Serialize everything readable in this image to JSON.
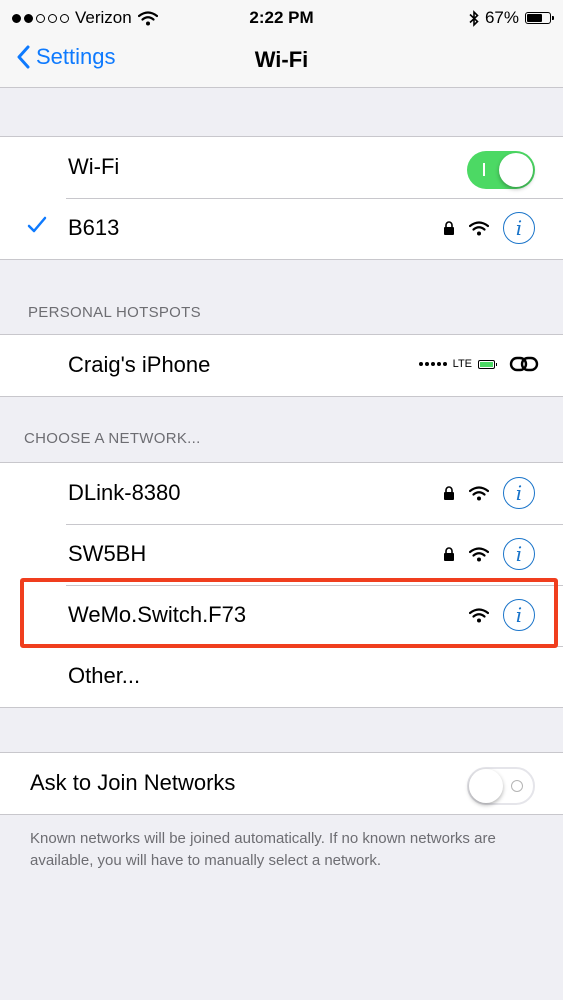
{
  "status_bar": {
    "carrier": "Verizon",
    "time": "2:22 PM",
    "battery": "67%",
    "battery_level": 0.67,
    "signal_bars": 2,
    "icons": [
      "wifi-icon",
      "bluetooth-icon",
      "battery-icon"
    ]
  },
  "nav": {
    "back_label": "Settings",
    "title": "Wi-Fi"
  },
  "wifi": {
    "toggle_label": "Wi-Fi",
    "toggle_on": true,
    "connected_network": "B613"
  },
  "hotspots": {
    "header": "PERSONAL HOTSPOTS",
    "items": [
      {
        "name": "Craig's iPhone",
        "network_type": "LTE"
      }
    ]
  },
  "networks": {
    "header": "CHOOSE A NETWORK...",
    "items": [
      {
        "name": "DLink-8380",
        "secured": true
      },
      {
        "name": "SW5BH",
        "secured": true
      },
      {
        "name": "WeMo.Switch.F73",
        "secured": false,
        "highlighted": true
      },
      {
        "name": "Other..."
      }
    ]
  },
  "ask_to_join": {
    "label": "Ask to Join Networks",
    "toggle_on": false,
    "footer": "Known networks will be joined automatically. If no known networks are available, you will have to manually select a network."
  },
  "colors": {
    "accent": "#0e7afe",
    "toggle_on": "#4cd964",
    "highlight_box": "#f03e1e",
    "background": "#efeff4"
  }
}
